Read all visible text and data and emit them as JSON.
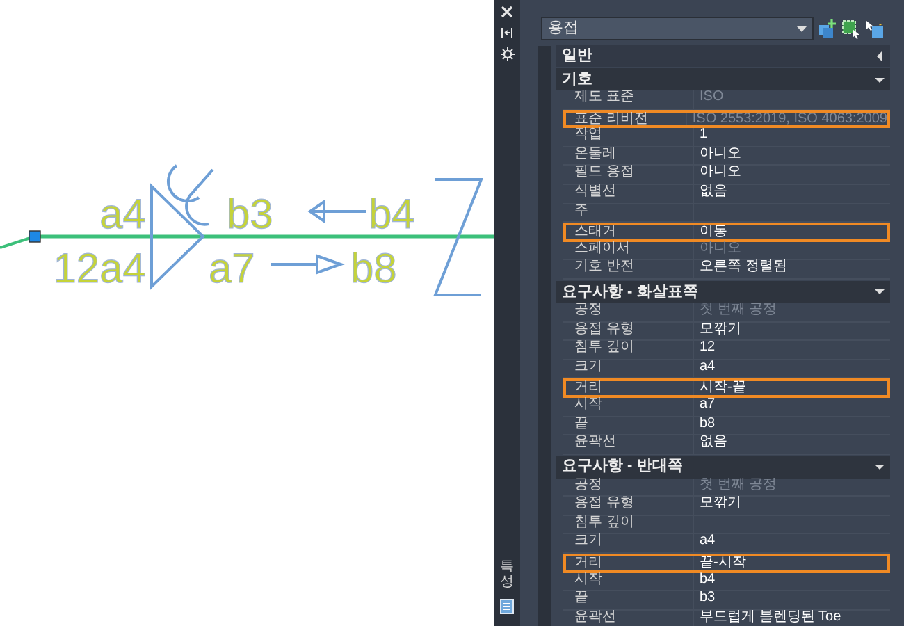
{
  "drawing": {
    "labels": [
      "a4",
      "b3",
      "b4",
      "12a4",
      "a7",
      "b8"
    ]
  },
  "palette": {
    "side_label": "특성",
    "object_type": "용접",
    "sections": [
      {
        "title": "일반",
        "expanded": false
      },
      {
        "title": "기호",
        "expanded": true,
        "rows": [
          {
            "label": "제도 표준",
            "value": "ISO",
            "disabled": true,
            "highlighted": false
          },
          {
            "label": "표준 리비전",
            "value": "ISO 2553:2019, ISO 4063:2009",
            "disabled": true,
            "highlighted": true
          },
          {
            "label": "작업",
            "value": "1",
            "disabled": false,
            "highlighted": false
          },
          {
            "label": "온둘레",
            "value": "아니오",
            "disabled": false,
            "highlighted": false
          },
          {
            "label": "필드 용접",
            "value": "아니오",
            "disabled": false,
            "highlighted": false
          },
          {
            "label": "식별선",
            "value": "없음",
            "disabled": false,
            "highlighted": false
          },
          {
            "label": "주",
            "value": "",
            "disabled": false,
            "highlighted": false
          },
          {
            "label": "스태거",
            "value": "이동",
            "disabled": false,
            "highlighted": true
          },
          {
            "label": "스페이서",
            "value": "아니오",
            "disabled": true,
            "highlighted": false
          },
          {
            "label": "기호 반전",
            "value": "오른쪽 정렬됨",
            "disabled": false,
            "highlighted": false
          }
        ]
      },
      {
        "title": "요구사항 - 화살표쪽",
        "expanded": true,
        "rows": [
          {
            "label": "공정",
            "value": "첫 번째 공정",
            "disabled": true,
            "highlighted": false
          },
          {
            "label": "용접 유형",
            "value": "모깎기",
            "disabled": false,
            "highlighted": false
          },
          {
            "label": "침투 깊이",
            "value": "12",
            "disabled": false,
            "highlighted": false
          },
          {
            "label": "크기",
            "value": "a4",
            "disabled": false,
            "highlighted": false
          },
          {
            "label": "거리",
            "value": "시작-끝",
            "disabled": false,
            "highlighted": true
          },
          {
            "label": "시작",
            "value": "a7",
            "disabled": false,
            "highlighted": false
          },
          {
            "label": "끝",
            "value": "b8",
            "disabled": false,
            "highlighted": false
          },
          {
            "label": "윤곽선",
            "value": "없음",
            "disabled": false,
            "highlighted": false
          }
        ]
      },
      {
        "title": "요구사항 - 반대쪽",
        "expanded": true,
        "rows": [
          {
            "label": "공정",
            "value": "첫 번째 공정",
            "disabled": true,
            "highlighted": false
          },
          {
            "label": "용접 유형",
            "value": "모깎기",
            "disabled": false,
            "highlighted": false
          },
          {
            "label": "침투 깊이",
            "value": "",
            "disabled": false,
            "highlighted": false
          },
          {
            "label": "크기",
            "value": "a4",
            "disabled": false,
            "highlighted": false
          },
          {
            "label": "거리",
            "value": "끝-시작",
            "disabled": false,
            "highlighted": true
          },
          {
            "label": "시작",
            "value": "b4",
            "disabled": false,
            "highlighted": false
          },
          {
            "label": "끝",
            "value": "b3",
            "disabled": false,
            "highlighted": false
          },
          {
            "label": "윤곽선",
            "value": "부드럽게 블렌딩된 Toe",
            "disabled": false,
            "highlighted": false
          }
        ]
      }
    ]
  }
}
